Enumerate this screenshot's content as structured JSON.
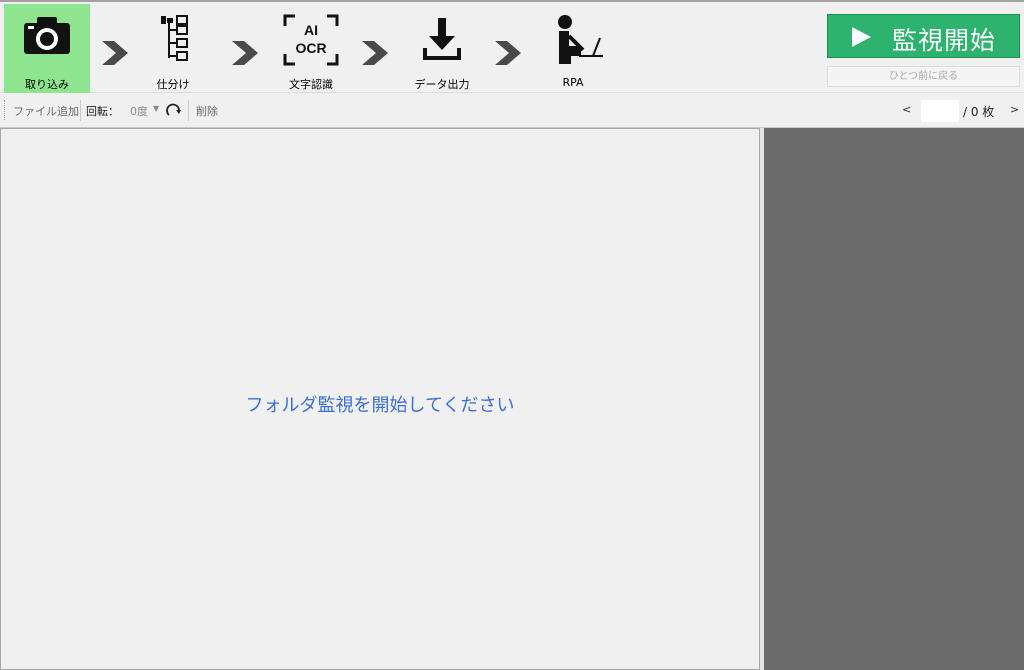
{
  "steps": [
    {
      "label": "取り込み",
      "icon": "camera-icon",
      "active": true
    },
    {
      "label": "仕分け",
      "icon": "sort-tree-icon",
      "active": false
    },
    {
      "label": "文字認識",
      "icon": "ai-ocr-icon",
      "active": false
    },
    {
      "label": "データ出力",
      "icon": "download-icon",
      "active": false
    },
    {
      "label": "RPA",
      "icon": "person-at-computer-icon",
      "active": false
    }
  ],
  "controls": {
    "start_label": "監視開始",
    "back_label": "ひとつ前に戻る"
  },
  "toolbar": {
    "add_file": "ファイル追加",
    "rotate_label": "回転：",
    "rotate_value": "0度",
    "delete": "削除",
    "nav_prev": "<",
    "nav_next": ">",
    "page_value": "",
    "page_total": "/ 0 枚"
  },
  "main": {
    "empty_message": "フォルダ監視を開始してください"
  },
  "colors": {
    "active_step": "#8fe58f",
    "start_button": "#2db36e",
    "message": "#3a6fd8",
    "preview_pane": "#6b6b6b"
  }
}
